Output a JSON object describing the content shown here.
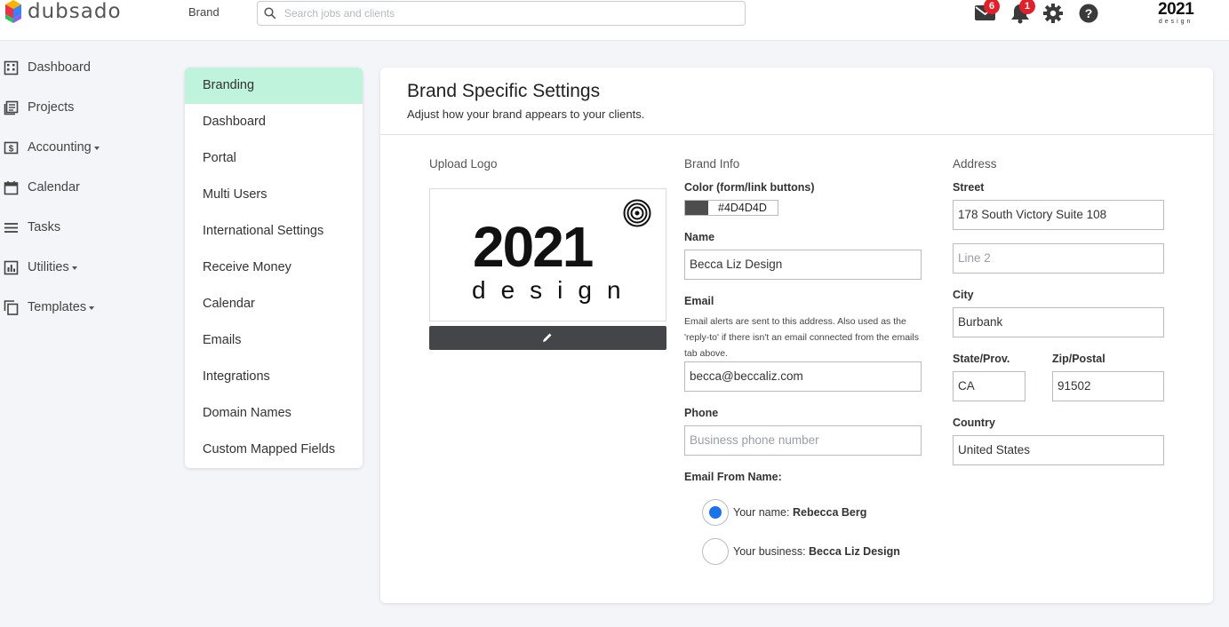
{
  "app": {
    "name": "dubsado"
  },
  "header": {
    "breadcrumb": "Brand",
    "search_placeholder": "Search jobs and clients",
    "mail_count": "6",
    "notification_count": "1",
    "brand_logo_number": "2021",
    "brand_logo_word": "design"
  },
  "sidebar": {
    "items": [
      {
        "label": "Dashboard",
        "icon": "building-icon",
        "dropdown": false
      },
      {
        "label": "Projects",
        "icon": "projects-icon",
        "dropdown": false
      },
      {
        "label": "Accounting",
        "icon": "dollar-icon",
        "dropdown": true
      },
      {
        "label": "Calendar",
        "icon": "calendar-icon",
        "dropdown": false
      },
      {
        "label": "Tasks",
        "icon": "list-icon",
        "dropdown": false
      },
      {
        "label": "Utilities",
        "icon": "bar-chart-icon",
        "dropdown": true
      },
      {
        "label": "Templates",
        "icon": "copy-icon",
        "dropdown": true
      }
    ]
  },
  "settings_menu": {
    "active_index": 0,
    "items": [
      "Branding",
      "Dashboard",
      "Portal",
      "Multi Users",
      "International Settings",
      "Receive Money",
      "Calendar",
      "Emails",
      "Integrations",
      "Domain Names",
      "Custom Mapped Fields"
    ]
  },
  "card": {
    "title": "Brand Specific Settings",
    "subtitle": "Adjust how your brand appears to your clients."
  },
  "upload_logo": {
    "heading": "Upload Logo",
    "logo_number": "2021",
    "logo_word": "design"
  },
  "brand_info": {
    "heading": "Brand Info",
    "color_label": "Color (form/link buttons)",
    "color_value": "#4D4D4D",
    "color_hex": "#4D4D4D",
    "name_label": "Name",
    "name_value": "Becca Liz Design",
    "email_label": "Email",
    "email_help": "Email alerts are sent to this address. Also used as the 'reply-to' if there isn't an email connected from the emails tab above.",
    "email_value": "becca@beccaliz.com",
    "phone_label": "Phone",
    "phone_placeholder": "Business phone number",
    "email_from_label": "Email From Name:",
    "option_name_prefix": "Your name:",
    "option_name_value": "Rebecca Berg",
    "option_business_prefix": "Your business:",
    "option_business_value": "Becca Liz Design",
    "selected_option": "name"
  },
  "address": {
    "heading": "Address",
    "street_label": "Street",
    "street_value": "178 South Victory Suite 108",
    "line2_placeholder": "Line 2",
    "city_label": "City",
    "city_value": "Burbank",
    "state_label": "State/Prov.",
    "state_value": "CA",
    "zip_label": "Zip/Postal",
    "zip_value": "91502",
    "country_label": "Country",
    "country_value": "United States"
  }
}
